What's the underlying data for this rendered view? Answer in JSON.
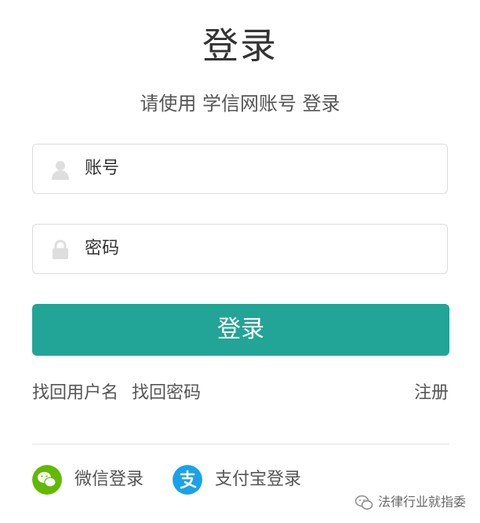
{
  "title": "登录",
  "subtitle": "请使用 学信网账号 登录",
  "form": {
    "account_placeholder": "账号",
    "password_placeholder": "密码",
    "account_icon": "user-icon",
    "password_icon": "lock-icon"
  },
  "login_button": "登录",
  "links": {
    "find_username": "找回用户名",
    "find_password": "找回密码",
    "register": "注册"
  },
  "social": {
    "wechat_label": "微信登录",
    "alipay_label": "支付宝登录",
    "wechat_icon": "wechat-icon",
    "alipay_icon": "alipay-icon"
  },
  "watermark": "法律行业就指委",
  "colors": {
    "primary": "#22a596",
    "wechat": "#62b900",
    "alipay": "#1aa2e9"
  }
}
